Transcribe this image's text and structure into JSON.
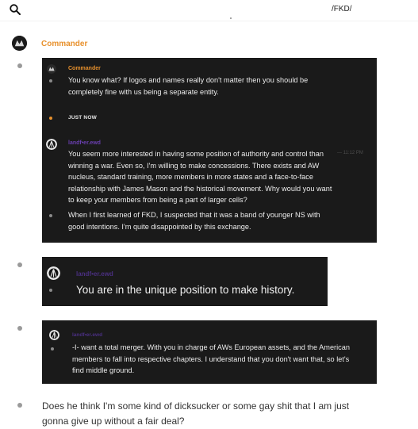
{
  "topbar": {
    "search_icon": "search-icon",
    "channel": "/FKD/"
  },
  "commander_header": {
    "name": "Commander",
    "avatar_icon": "commander-avatar"
  },
  "quoted_thread": {
    "msg1": {
      "author": "Commander",
      "text": "You know what? If logos and names really don't matter then you should be completely fine with us being a separate entity."
    },
    "status": "JUST NOW",
    "msg2": {
      "author": "landf•er.ewd",
      "time": "— 11:12 PM",
      "text": "You seem more interested in having some position of authority and control than winning a war. Even so, I'm willing to make concessions. There exists and AW nucleus, standard training, more members in more states and a face-to-face relationship with James Mason and the historical movement. Why would you want to keep your members from being a part of larger cells?",
      "text2": "When I first learned of FKD, I suspected that it was a band of younger NS with good intentions. I'm quite disappointed by this exchange."
    }
  },
  "quote2": {
    "author": "landf•er.ewd",
    "text": "You are in the unique position to make history."
  },
  "quote3": {
    "author": "landf•er.ewd",
    "text": "-I- want a total merger. With you in charge of AWs European assets, and the American members to fall into respective chapters. I understand that you don't want that, so let's find middle ground."
  },
  "plain_message": {
    "text": "Does he think I'm some kind of dicksucker or some gay shit that I am just gonna give up without a fair deal?"
  },
  "colors": {
    "commander": "#e8912d",
    "landfer": "#6a3fb0",
    "dark_bg": "#1a1a1a"
  }
}
